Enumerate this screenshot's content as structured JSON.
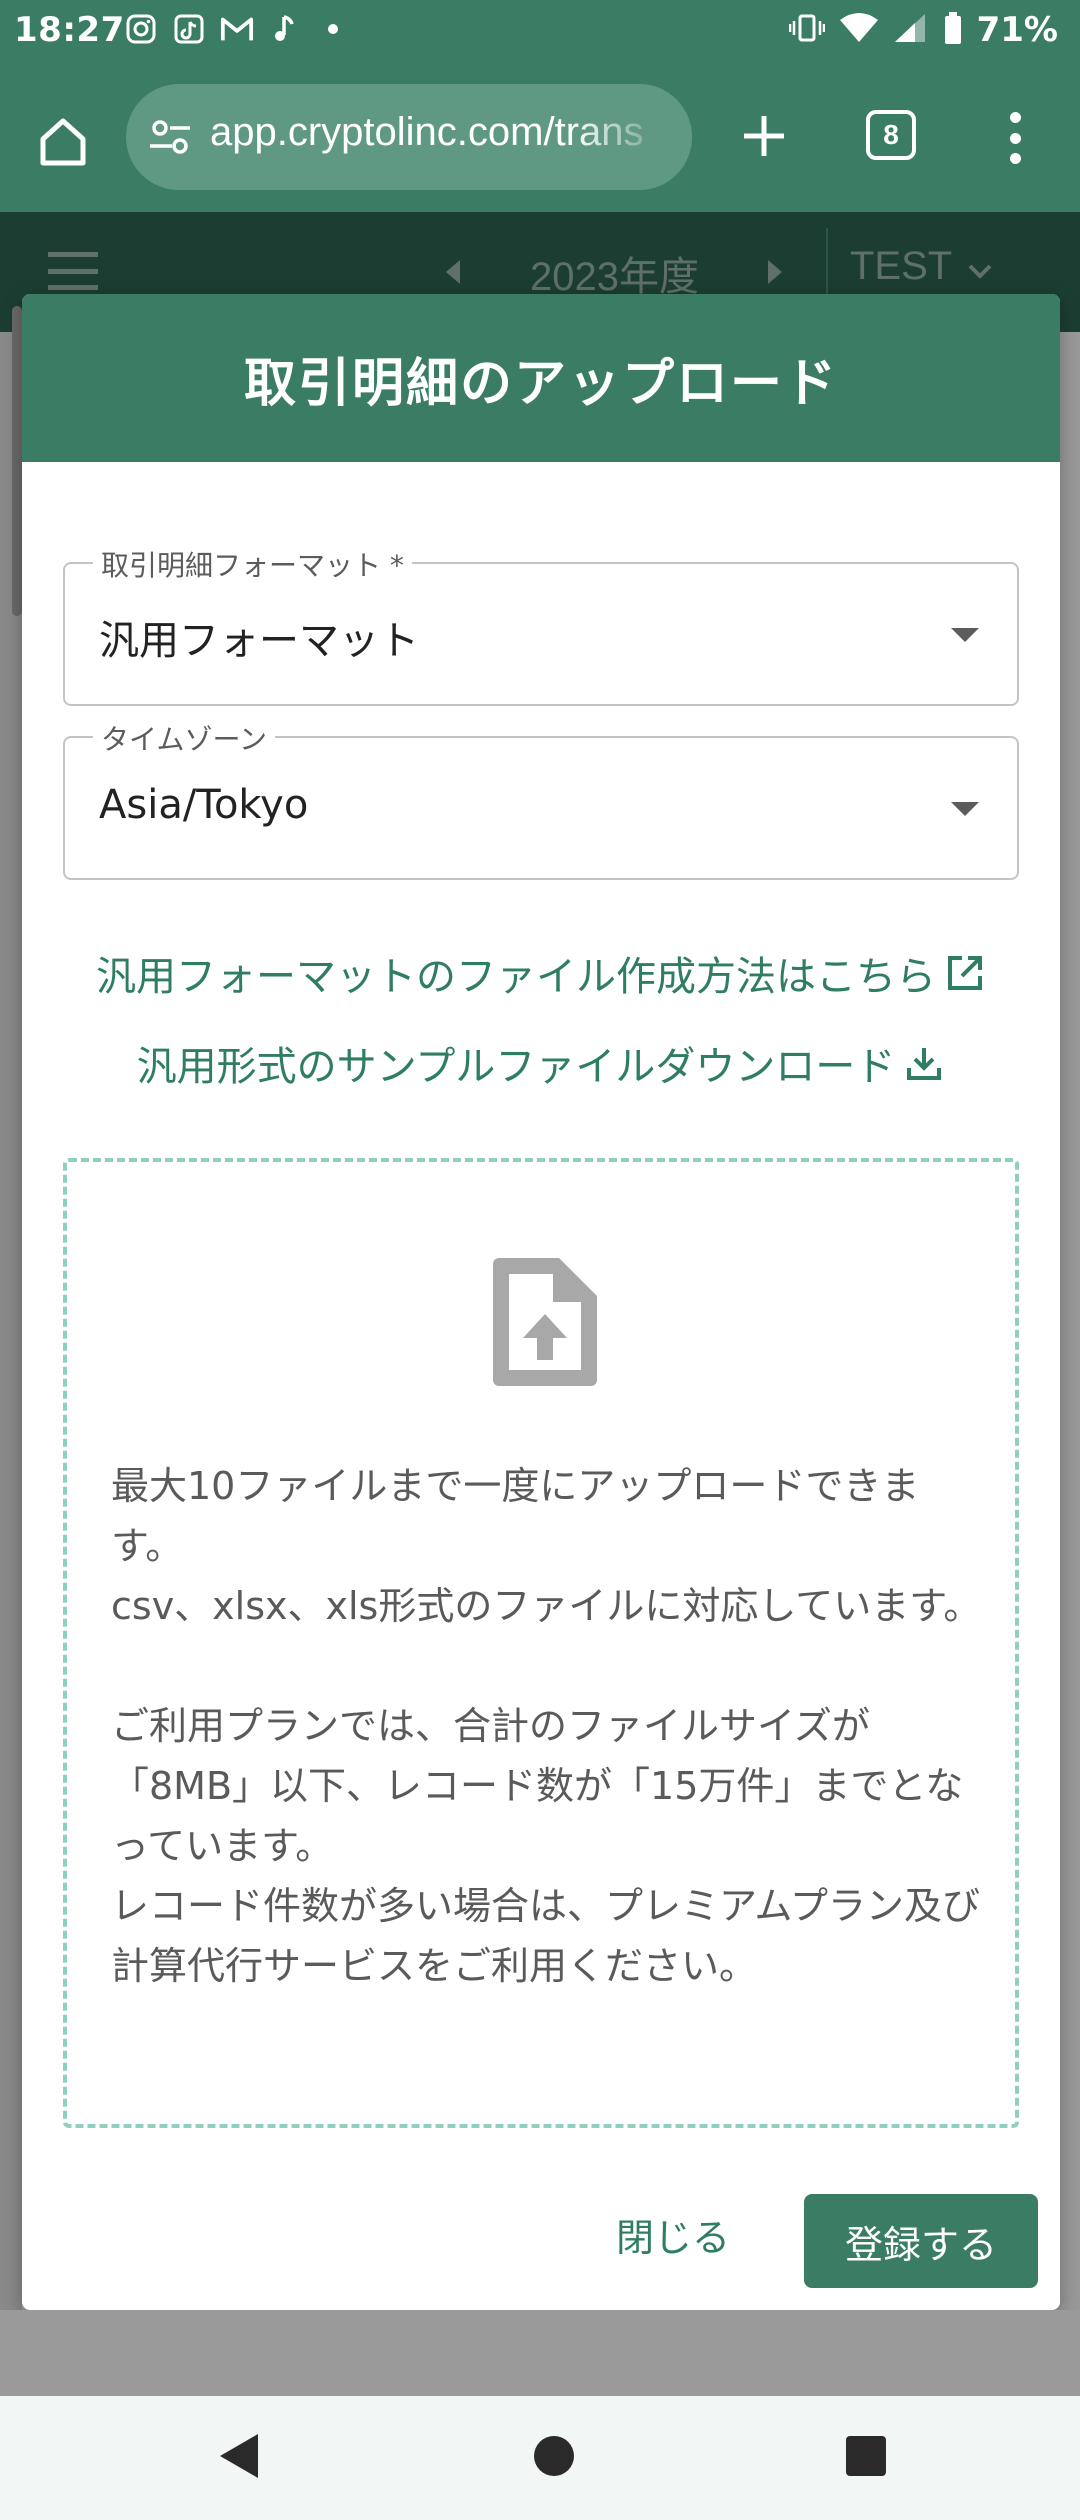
{
  "status_bar": {
    "time": "18:27",
    "battery_percent": "71%",
    "icons_left": [
      "instagram-icon",
      "tiktok-icon",
      "gmail-icon",
      "music-icon",
      "dot-icon"
    ],
    "icons_right": [
      "vibrate-icon",
      "wifi-icon",
      "signal-icon",
      "battery-icon"
    ]
  },
  "browser": {
    "url": "app.cryptolinc.com/trans",
    "tab_count": "8"
  },
  "app_header": {
    "year": "2023年度",
    "project": "TEST"
  },
  "dialog": {
    "title": "取引明細のアップロード",
    "format_field": {
      "label": "取引明細フォーマット *",
      "value": "汎用フォーマット"
    },
    "timezone_field": {
      "label": "タイムゾーン",
      "value": "Asia/Tokyo"
    },
    "links": {
      "how_to": "汎用フォーマットのファイル作成方法はこちら",
      "sample_download": "汎用形式のサンプルファイルダウンロード"
    },
    "dropzone": {
      "text": "最大10ファイルまで一度にアップロードできます。\ncsv、xlsx、xls形式のファイルに対応しています。\n\nご利用プランでは、合計のファイルサイズが「8MB」以下、レコード数が「15万件」までとなっています。\nレコード件数が多い場合は、プレミアムプラン及び計算代行サービスをご利用ください。"
    },
    "buttons": {
      "close": "閉じる",
      "submit": "登録する"
    }
  },
  "colors": {
    "primary": "#3a7d64",
    "link": "#2f7e62",
    "dropzone_border": "#8fcfc0"
  }
}
